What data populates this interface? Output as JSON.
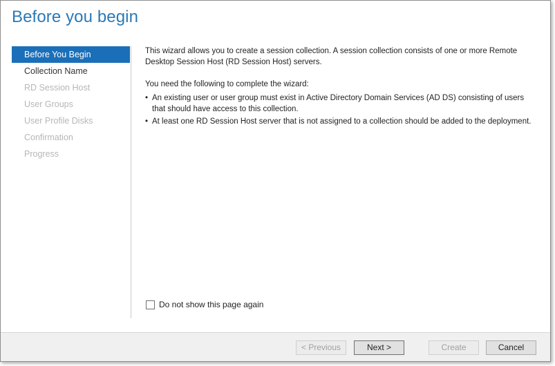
{
  "page": {
    "title": "Before you begin"
  },
  "nav": {
    "items": [
      {
        "label": "Before You Begin",
        "state": "active"
      },
      {
        "label": "Collection Name",
        "state": "enabled"
      },
      {
        "label": "RD Session Host",
        "state": "disabled"
      },
      {
        "label": "User Groups",
        "state": "disabled"
      },
      {
        "label": "User Profile Disks",
        "state": "disabled"
      },
      {
        "label": "Confirmation",
        "state": "disabled"
      },
      {
        "label": "Progress",
        "state": "disabled"
      }
    ]
  },
  "content": {
    "intro": "This wizard allows you to create a session collection. A session collection consists of one or more Remote Desktop Session Host (RD Session Host) servers.",
    "need_heading": "You need the following to complete the wizard:",
    "bullet_symbol": "•",
    "bullets": [
      "An existing user or user group must exist in Active Directory Domain Services (AD DS) consisting of users that should have access to this collection.",
      "At least one RD Session Host server that is not assigned to a collection should be added to the deployment."
    ],
    "dont_show_label": "Do not show this page again",
    "dont_show_checked": false
  },
  "footer": {
    "previous_label": "< Previous",
    "next_label": "Next >",
    "create_label": "Create",
    "cancel_label": "Cancel"
  },
  "colors": {
    "title": "#2b79b6",
    "nav_active_bg": "#1b6fb8",
    "nav_disabled_text": "#b6b6b6"
  }
}
